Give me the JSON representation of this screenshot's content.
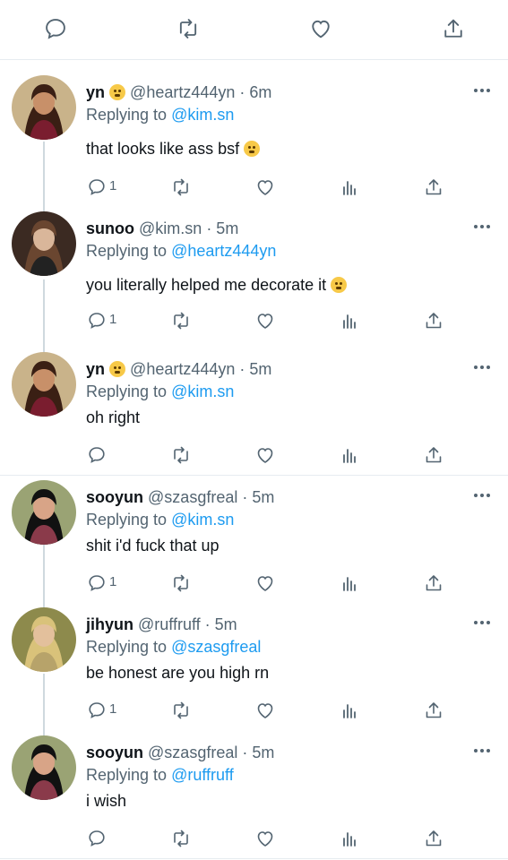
{
  "top_actions": [
    "reply",
    "retweet",
    "like",
    "share"
  ],
  "tweets": [
    {
      "name": "yn",
      "handle": "@heartz444yn",
      "time": "· 6m",
      "emoji_after_name": true,
      "reply_prefix": "Replying to",
      "reply_to": "@kim.sn",
      "text": "that looks like ass bsf",
      "text_emoji": true,
      "reply_count": "1",
      "avatar": {
        "bg": "#c9b38a",
        "hair": "#3a1f14",
        "skin": "#c89069",
        "cloth": "#7a1d2f"
      }
    },
    {
      "name": "sunoo",
      "handle": "@kim.sn",
      "time": "· 5m",
      "emoji_after_name": false,
      "reply_prefix": "Replying to",
      "reply_to": "@heartz444yn",
      "text": "you literally helped me decorate it",
      "text_emoji": true,
      "reply_count": "1",
      "avatar": {
        "bg": "#3b2a22",
        "hair": "#6a4630",
        "skin": "#d9b69a",
        "cloth": "#222222"
      }
    },
    {
      "name": "yn",
      "handle": "@heartz444yn",
      "time": "· 5m",
      "emoji_after_name": true,
      "reply_prefix": "Replying to",
      "reply_to": "@kim.sn",
      "text": "oh right",
      "text_emoji": false,
      "reply_count": "",
      "avatar": {
        "bg": "#c9b38a",
        "hair": "#3a1f14",
        "skin": "#c89069",
        "cloth": "#7a1d2f"
      }
    },
    {
      "name": "sooyun",
      "handle": "@szasgfreal",
      "time": "· 5m",
      "emoji_after_name": false,
      "reply_prefix": "Replying to",
      "reply_to": "@kim.sn",
      "text": "shit i'd fuck that up",
      "text_emoji": false,
      "reply_count": "1",
      "avatar": {
        "bg": "#9aa374",
        "hair": "#111111",
        "skin": "#d8a487",
        "cloth": "#8a3a4a"
      }
    },
    {
      "name": "jihyun",
      "handle": "@ruffruff",
      "time": "· 5m",
      "emoji_after_name": false,
      "reply_prefix": "Replying to",
      "reply_to": "@szasgfreal",
      "text": "be honest are you high rn",
      "text_emoji": false,
      "reply_count": "1",
      "avatar": {
        "bg": "#8d8a4c",
        "hair": "#d9c27a",
        "skin": "#e3c09c",
        "cloth": "#b7a36a"
      }
    },
    {
      "name": "sooyun",
      "handle": "@szasgfreal",
      "time": "· 5m",
      "emoji_after_name": false,
      "reply_prefix": "Replying to",
      "reply_to": "@ruffruff",
      "text": "i wish",
      "text_emoji": false,
      "reply_count": "",
      "avatar": {
        "bg": "#9aa374",
        "hair": "#111111",
        "skin": "#d8a487",
        "cloth": "#8a3a4a"
      }
    }
  ],
  "colors": {
    "mention": "#1d9bf0",
    "secondary": "#536471",
    "divider": "#e6ecf0"
  }
}
